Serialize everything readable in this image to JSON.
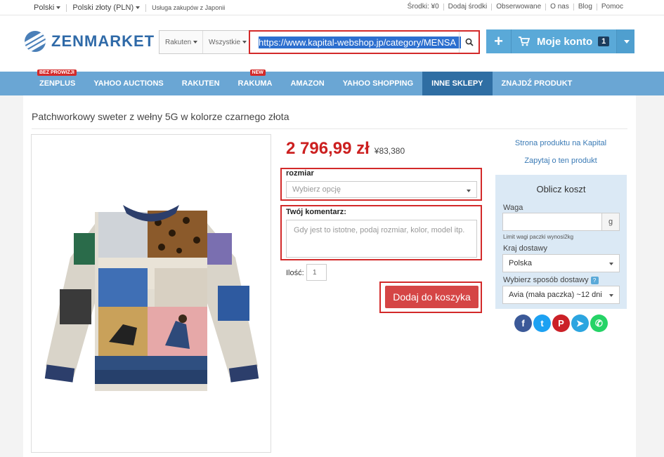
{
  "topbar": {
    "language": "Polski",
    "currency": "Polski złoty (PLN)",
    "service": "Usługa zakupów z Japonii",
    "links": [
      "Środki: ¥0",
      "Dodaj środki",
      "Obserwowane",
      "O nas",
      "Blog",
      "Pomoc"
    ]
  },
  "header": {
    "logo": "ZENMARKET",
    "search": {
      "store_select": "Rakuten",
      "category_select": "Wszystkie",
      "url_value": "https://www.kapital-webshop.jp/category/MENSA"
    },
    "account": {
      "label": "Moje konto",
      "cart_count": "1"
    }
  },
  "nav": {
    "items": [
      {
        "label": "ZENPLUS",
        "tag": "BEZ PROWIZJI"
      },
      {
        "label": "YAHOO AUCTIONS",
        "tag": ""
      },
      {
        "label": "RAKUTEN",
        "tag": ""
      },
      {
        "label": "RAKUMA",
        "tag": "NEW"
      },
      {
        "label": "AMAZON",
        "tag": ""
      },
      {
        "label": "YAHOO SHOPPING",
        "tag": ""
      },
      {
        "label": "INNE SKLEPY",
        "tag": ""
      },
      {
        "label": "ZNAJDŹ PRODUKT",
        "tag": ""
      }
    ],
    "active": "INNE SKLEPY"
  },
  "product": {
    "title": "Patchworkowy sweter z wełny 5G w kolorze czarnego złota",
    "price_pln": "2 796,99 zł",
    "price_jpy": "¥83,380",
    "size_label": "rozmiar",
    "size_placeholder": "Wybierz opcję",
    "comment_label": "Twój komentarz:",
    "comment_placeholder": "Gdy jest to istotne, podaj rozmiar, kolor, model itp.",
    "qty_label": "Ilość:",
    "qty_value": "1",
    "add_button": "Dodaj do koszyka"
  },
  "sidebar": {
    "product_page_link": "Strona produktu na Kapital",
    "ask_link": "Zapytaj o ten produkt",
    "calc": {
      "title": "Oblicz koszt",
      "weight_label": "Waga",
      "weight_unit": "g",
      "weight_note": "Limit wagi paczki wynosi2kg",
      "country_label": "Kraj dostawy",
      "country_value": "Polska",
      "shipping_label": "Wybierz sposób dostawy",
      "shipping_help": "?",
      "shipping_value": "Avia (mała paczka) ~12 dni"
    }
  },
  "social": [
    {
      "name": "facebook",
      "glyph": "f",
      "color": "#3b5998"
    },
    {
      "name": "twitter",
      "glyph": "t",
      "color": "#1da1f2"
    },
    {
      "name": "pinterest",
      "glyph": "P",
      "color": "#cb2027"
    },
    {
      "name": "telegram",
      "glyph": "➤",
      "color": "#2ca5e0"
    },
    {
      "name": "whatsapp",
      "glyph": "✆",
      "color": "#25d366"
    }
  ],
  "colors": {
    "nav_bg": "#6aa6d4",
    "nav_active": "#2f6ea3",
    "price_red": "#cc2020",
    "add_button": "#d54545",
    "highlight_border": "#d32a2a"
  }
}
